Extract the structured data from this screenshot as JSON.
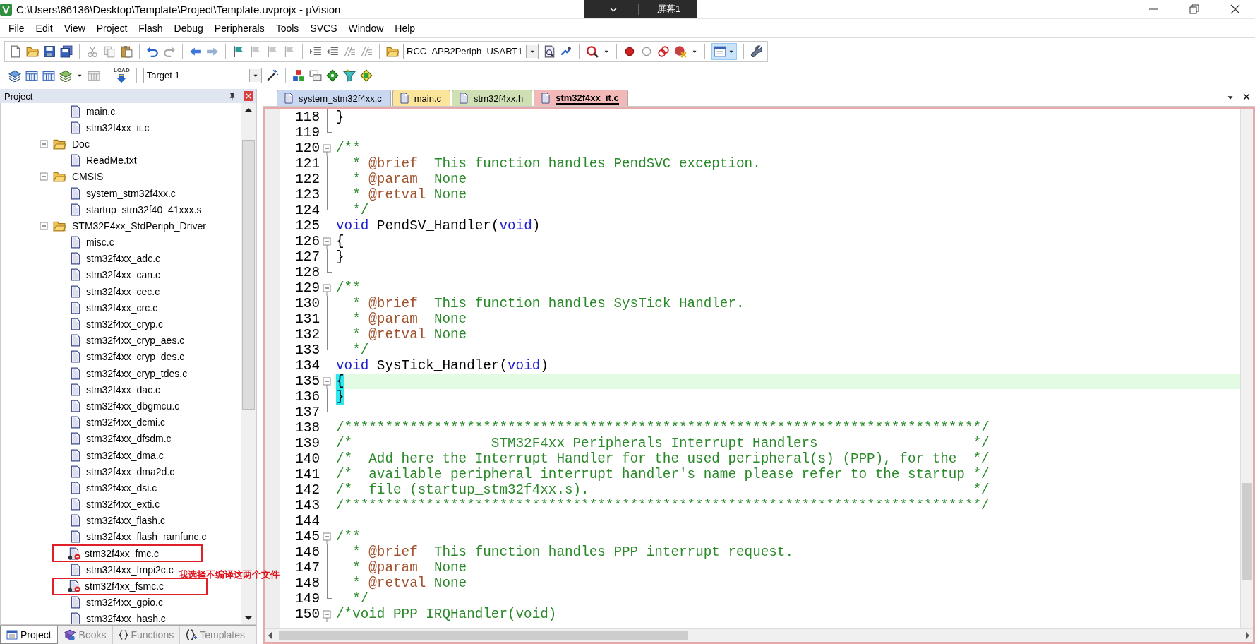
{
  "window": {
    "title": "C:\\Users\\86136\\Desktop\\Template\\Project\\Template.uvprojx - µVision",
    "screen_share_label": "屏幕1"
  },
  "menu": [
    "File",
    "Edit",
    "View",
    "Project",
    "Flash",
    "Debug",
    "Peripherals",
    "Tools",
    "SVCS",
    "Window",
    "Help"
  ],
  "toolbar": {
    "find_combo": "RCC_APB2Periph_USART1"
  },
  "build_toolbar": {
    "load_label": "LOAD",
    "target_combo": "Target 1"
  },
  "project_panel": {
    "title": "Project",
    "tree": [
      {
        "kind": "group",
        "children": [
          {
            "kind": "file",
            "label": "main.c",
            "excluded": false,
            "annotated": false
          },
          {
            "kind": "file",
            "label": "stm32f4xx_it.c",
            "excluded": false,
            "annotated": false
          }
        ]
      },
      {
        "kind": "folder",
        "label": "Doc",
        "expanded": true,
        "children": [
          {
            "kind": "file",
            "label": "ReadMe.txt",
            "excluded": false,
            "annotated": false
          }
        ]
      },
      {
        "kind": "folder",
        "label": "CMSIS",
        "expanded": true,
        "children": [
          {
            "kind": "file",
            "label": "system_stm32f4xx.c",
            "excluded": false,
            "annotated": false
          },
          {
            "kind": "file",
            "label": "startup_stm32f40_41xxx.s",
            "excluded": false,
            "annotated": false
          }
        ]
      },
      {
        "kind": "folder",
        "label": "STM32F4xx_StdPeriph_Driver",
        "expanded": true,
        "children": [
          {
            "kind": "file",
            "label": "misc.c",
            "excluded": false,
            "annotated": false
          },
          {
            "kind": "file",
            "label": "stm32f4xx_adc.c",
            "excluded": false,
            "annotated": false
          },
          {
            "kind": "file",
            "label": "stm32f4xx_can.c",
            "excluded": false,
            "annotated": false
          },
          {
            "kind": "file",
            "label": "stm32f4xx_cec.c",
            "excluded": false,
            "annotated": false
          },
          {
            "kind": "file",
            "label": "stm32f4xx_crc.c",
            "excluded": false,
            "annotated": false
          },
          {
            "kind": "file",
            "label": "stm32f4xx_cryp.c",
            "excluded": false,
            "annotated": false
          },
          {
            "kind": "file",
            "label": "stm32f4xx_cryp_aes.c",
            "excluded": false,
            "annotated": false
          },
          {
            "kind": "file",
            "label": "stm32f4xx_cryp_des.c",
            "excluded": false,
            "annotated": false
          },
          {
            "kind": "file",
            "label": "stm32f4xx_cryp_tdes.c",
            "excluded": false,
            "annotated": false
          },
          {
            "kind": "file",
            "label": "stm32f4xx_dac.c",
            "excluded": false,
            "annotated": false
          },
          {
            "kind": "file",
            "label": "stm32f4xx_dbgmcu.c",
            "excluded": false,
            "annotated": false
          },
          {
            "kind": "file",
            "label": "stm32f4xx_dcmi.c",
            "excluded": false,
            "annotated": false
          },
          {
            "kind": "file",
            "label": "stm32f4xx_dfsdm.c",
            "excluded": false,
            "annotated": false
          },
          {
            "kind": "file",
            "label": "stm32f4xx_dma.c",
            "excluded": false,
            "annotated": false
          },
          {
            "kind": "file",
            "label": "stm32f4xx_dma2d.c",
            "excluded": false,
            "annotated": false
          },
          {
            "kind": "file",
            "label": "stm32f4xx_dsi.c",
            "excluded": false,
            "annotated": false
          },
          {
            "kind": "file",
            "label": "stm32f4xx_exti.c",
            "excluded": false,
            "annotated": false
          },
          {
            "kind": "file",
            "label": "stm32f4xx_flash.c",
            "excluded": false,
            "annotated": false
          },
          {
            "kind": "file",
            "label": "stm32f4xx_flash_ramfunc.c",
            "excluded": false,
            "annotated": false
          },
          {
            "kind": "file",
            "label": "stm32f4xx_fmc.c",
            "excluded": true,
            "annotated": true
          },
          {
            "kind": "file",
            "label": "stm32f4xx_fmpi2c.c",
            "excluded": false,
            "annotated": false
          },
          {
            "kind": "file",
            "label": "stm32f4xx_fsmc.c",
            "excluded": true,
            "annotated": true
          },
          {
            "kind": "file",
            "label": "stm32f4xx_gpio.c",
            "excluded": false,
            "annotated": false
          },
          {
            "kind": "file",
            "label": "stm32f4xx_hash.c",
            "excluded": false,
            "annotated": false
          }
        ]
      }
    ],
    "tabs": [
      {
        "label": "Project",
        "selected": true
      },
      {
        "label": "Books",
        "selected": false
      },
      {
        "label": "Functions",
        "selected": false
      },
      {
        "label": "Templates",
        "selected": false
      }
    ]
  },
  "editor": {
    "tabs": [
      {
        "label": "system_stm32f4xx.c",
        "color": "#c9d8f0",
        "selected": false
      },
      {
        "label": "main.c",
        "color": "#fbe59a",
        "selected": false
      },
      {
        "label": "stm32f4xx.h",
        "color": "#cfe0b4",
        "selected": false
      },
      {
        "label": "stm32f4xx_it.c",
        "color": "#f3b9b9",
        "selected": true
      }
    ],
    "lines": [
      {
        "number": "118",
        "kind": "fold-body",
        "current": false,
        "segments": [
          {
            "kind": "plain",
            "text": "}"
          }
        ]
      },
      {
        "number": "119",
        "kind": "fold-end",
        "current": false
      },
      {
        "number": "120",
        "kind": "fold-start",
        "current": false,
        "segments": [
          {
            "kind": "comment",
            "text": "/**"
          }
        ]
      },
      {
        "number": "121",
        "kind": "fold-body",
        "current": false,
        "segments": [
          {
            "kind": "comment",
            "text": "  * "
          },
          {
            "kind": "doctag",
            "text": "@brief"
          },
          {
            "kind": "comment",
            "text": "  This function handles PendSVC exception."
          }
        ]
      },
      {
        "number": "122",
        "kind": "fold-body",
        "current": false,
        "segments": [
          {
            "kind": "comment",
            "text": "  * "
          },
          {
            "kind": "doctag",
            "text": "@param"
          },
          {
            "kind": "comment",
            "text": "  None"
          }
        ]
      },
      {
        "number": "123",
        "kind": "fold-body",
        "current": false,
        "segments": [
          {
            "kind": "comment",
            "text": "  * "
          },
          {
            "kind": "doctag",
            "text": "@retval"
          },
          {
            "kind": "comment",
            "text": " None"
          }
        ]
      },
      {
        "number": "124",
        "kind": "fold-end",
        "current": false,
        "segments": [
          {
            "kind": "comment",
            "text": "  */"
          }
        ]
      },
      {
        "number": "125",
        "kind": "plain",
        "current": false,
        "segments": [
          {
            "kind": "keyword",
            "text": "void"
          },
          {
            "kind": "plain",
            "text": " PendSV_Handler("
          },
          {
            "kind": "keyword",
            "text": "void"
          },
          {
            "kind": "plain",
            "text": ")"
          }
        ]
      },
      {
        "number": "126",
        "kind": "fold-start",
        "current": false,
        "segments": [
          {
            "kind": "plain",
            "text": "{"
          }
        ]
      },
      {
        "number": "127",
        "kind": "fold-body",
        "current": false,
        "segments": [
          {
            "kind": "plain",
            "text": "}"
          }
        ]
      },
      {
        "number": "128",
        "kind": "fold-end",
        "current": false
      },
      {
        "number": "129",
        "kind": "fold-start",
        "current": false,
        "segments": [
          {
            "kind": "comment",
            "text": "/**"
          }
        ]
      },
      {
        "number": "130",
        "kind": "fold-body",
        "current": false,
        "segments": [
          {
            "kind": "comment",
            "text": "  * "
          },
          {
            "kind": "doctag",
            "text": "@brief"
          },
          {
            "kind": "comment",
            "text": "  This function handles SysTick Handler."
          }
        ]
      },
      {
        "number": "131",
        "kind": "fold-body",
        "current": false,
        "segments": [
          {
            "kind": "comment",
            "text": "  * "
          },
          {
            "kind": "doctag",
            "text": "@param"
          },
          {
            "kind": "comment",
            "text": "  None"
          }
        ]
      },
      {
        "number": "132",
        "kind": "fold-body",
        "current": false,
        "segments": [
          {
            "kind": "comment",
            "text": "  * "
          },
          {
            "kind": "doctag",
            "text": "@retval"
          },
          {
            "kind": "comment",
            "text": " None"
          }
        ]
      },
      {
        "number": "133",
        "kind": "fold-end",
        "current": false,
        "segments": [
          {
            "kind": "comment",
            "text": "  */"
          }
        ]
      },
      {
        "number": "134",
        "kind": "plain",
        "current": false,
        "segments": [
          {
            "kind": "keyword",
            "text": "void"
          },
          {
            "kind": "plain",
            "text": " SysTick_Handler("
          },
          {
            "kind": "keyword",
            "text": "void"
          },
          {
            "kind": "plain",
            "text": ")"
          }
        ]
      },
      {
        "number": "135",
        "kind": "fold-start",
        "current": true,
        "segments": [
          {
            "kind": "brace-match",
            "text": "{"
          }
        ]
      },
      {
        "number": "136",
        "kind": "fold-body",
        "current": false,
        "segments": [
          {
            "kind": "brace-match",
            "text": "}"
          }
        ]
      },
      {
        "number": "137",
        "kind": "fold-end",
        "current": false
      },
      {
        "number": "138",
        "kind": "plain",
        "current": false,
        "segments": [
          {
            "kind": "comment",
            "text": "/******************************************************************************/"
          }
        ]
      },
      {
        "number": "139",
        "kind": "plain",
        "current": false,
        "segments": [
          {
            "kind": "comment",
            "text": "/*                 STM32F4xx Peripherals Interrupt Handlers                   */"
          }
        ]
      },
      {
        "number": "140",
        "kind": "plain",
        "current": false,
        "segments": [
          {
            "kind": "comment",
            "text": "/*  Add here the Interrupt Handler for the used peripheral(s) (PPP), for the  */"
          }
        ]
      },
      {
        "number": "141",
        "kind": "plain",
        "current": false,
        "segments": [
          {
            "kind": "comment",
            "text": "/*  available peripheral interrupt handler's name please refer to the startup */"
          }
        ]
      },
      {
        "number": "142",
        "kind": "plain",
        "current": false,
        "segments": [
          {
            "kind": "comment",
            "text": "/*  file (startup_stm32f4xx.s).                                               */"
          }
        ]
      },
      {
        "number": "143",
        "kind": "plain",
        "current": false,
        "segments": [
          {
            "kind": "comment",
            "text": "/******************************************************************************/"
          }
        ]
      },
      {
        "number": "144",
        "kind": "plain",
        "current": false
      },
      {
        "number": "145",
        "kind": "fold-start",
        "current": false,
        "segments": [
          {
            "kind": "comment",
            "text": "/**"
          }
        ]
      },
      {
        "number": "146",
        "kind": "fold-body",
        "current": false,
        "segments": [
          {
            "kind": "comment",
            "text": "  * "
          },
          {
            "kind": "doctag",
            "text": "@brief"
          },
          {
            "kind": "comment",
            "text": "  This function handles PPP interrupt request."
          }
        ]
      },
      {
        "number": "147",
        "kind": "fold-body",
        "current": false,
        "segments": [
          {
            "kind": "comment",
            "text": "  * "
          },
          {
            "kind": "doctag",
            "text": "@param"
          },
          {
            "kind": "comment",
            "text": "  None"
          }
        ]
      },
      {
        "number": "148",
        "kind": "fold-body",
        "current": false,
        "segments": [
          {
            "kind": "comment",
            "text": "  * "
          },
          {
            "kind": "doctag",
            "text": "@retval"
          },
          {
            "kind": "comment",
            "text": " None"
          }
        ]
      },
      {
        "number": "149",
        "kind": "fold-end",
        "current": false,
        "segments": [
          {
            "kind": "comment",
            "text": "  */"
          }
        ]
      },
      {
        "number": "150",
        "kind": "fold-start",
        "current": false,
        "segments": [
          {
            "kind": "comment",
            "text": "/*void PPP_IRQHandler(void)"
          }
        ]
      }
    ]
  },
  "annotation": {
    "text": "我选择不编译这两个文件"
  }
}
